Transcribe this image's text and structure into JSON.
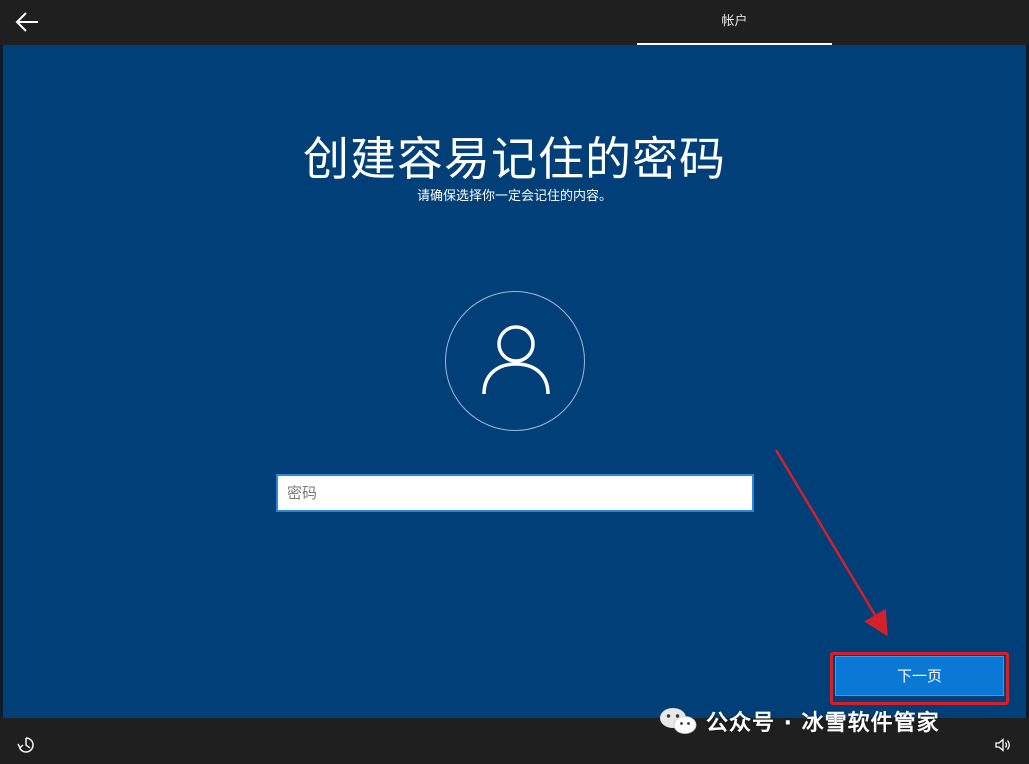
{
  "header": {
    "tab_label": "帐户"
  },
  "main": {
    "title": "创建容易记住的密码",
    "subtitle": "请确保选择你一定会记住的内容。",
    "password_placeholder": "密码",
    "next_label": "下一页"
  },
  "watermark": {
    "text": "公众号 · 冰雪软件管家"
  },
  "icons": {
    "back": "back-arrow-icon",
    "avatar": "user-icon",
    "accessibility": "ease-of-access-icon",
    "volume": "volume-icon",
    "watermark_logo": "wechat-logo"
  },
  "colors": {
    "background": "#003f78",
    "bars": "#1f1f1f",
    "button": "#0a78d4",
    "annotation": "#d4202a"
  }
}
